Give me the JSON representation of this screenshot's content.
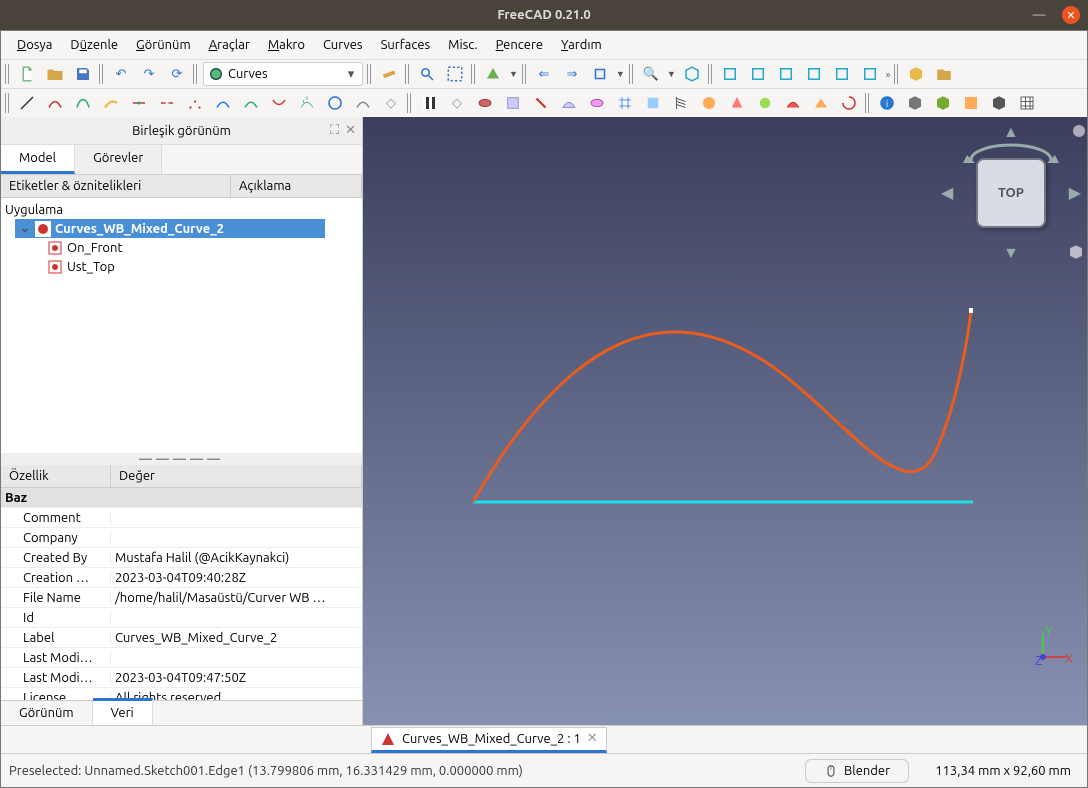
{
  "title": "FreeCAD 0.21.0",
  "menus": [
    "Dosya",
    "Düzenle",
    "Görünüm",
    "Araçlar",
    "Makro",
    "Curves",
    "Surfaces",
    "Misc.",
    "Pencere",
    "Yardım"
  ],
  "workbench": {
    "name": "Curves"
  },
  "combo_view": {
    "title": "Birleşik görünüm",
    "tabs": {
      "model": "Model",
      "tasks": "Görevler"
    },
    "tree_headers": {
      "labels": "Etiketler & öznitelikleri",
      "desc": "Açıklama"
    },
    "root": "Uygulama",
    "doc": "Curves_WB_Mixed_Curve_2",
    "children": [
      "On_Front",
      "Ust_Top"
    ]
  },
  "props": {
    "headers": {
      "prop": "Özellik",
      "val": "Değer"
    },
    "group": "Baz",
    "rows": [
      {
        "k": "Comment",
        "v": ""
      },
      {
        "k": "Company",
        "v": ""
      },
      {
        "k": "Created By",
        "v": "Mustafa Halil (@AcikKaynakci)"
      },
      {
        "k": "Creation …",
        "v": "2023-03-04T09:40:28Z"
      },
      {
        "k": "File Name",
        "v": "/home/halil/Masaüstü/Curver WB …"
      },
      {
        "k": "Id",
        "v": ""
      },
      {
        "k": "Label",
        "v": "Curves_WB_Mixed_Curve_2"
      },
      {
        "k": "Last Modi…",
        "v": ""
      },
      {
        "k": "Last Modi…",
        "v": "2023-03-04T09:47:50Z"
      },
      {
        "k": "License",
        "v": "All rights reserved"
      }
    ],
    "bottom_tabs": {
      "view": "Görünüm",
      "data": "Veri"
    }
  },
  "navcube": {
    "face": "TOP"
  },
  "mdi_tab": "Curves_WB_Mixed_Curve_2 : 1",
  "status": {
    "text": "Preselected: Unnamed.Sketch001.Edge1 (13.799806 mm, 16.331429 mm, 0.000000 mm)",
    "navstyle": "Blender",
    "dims": "113,34 mm x 92,60 mm"
  }
}
